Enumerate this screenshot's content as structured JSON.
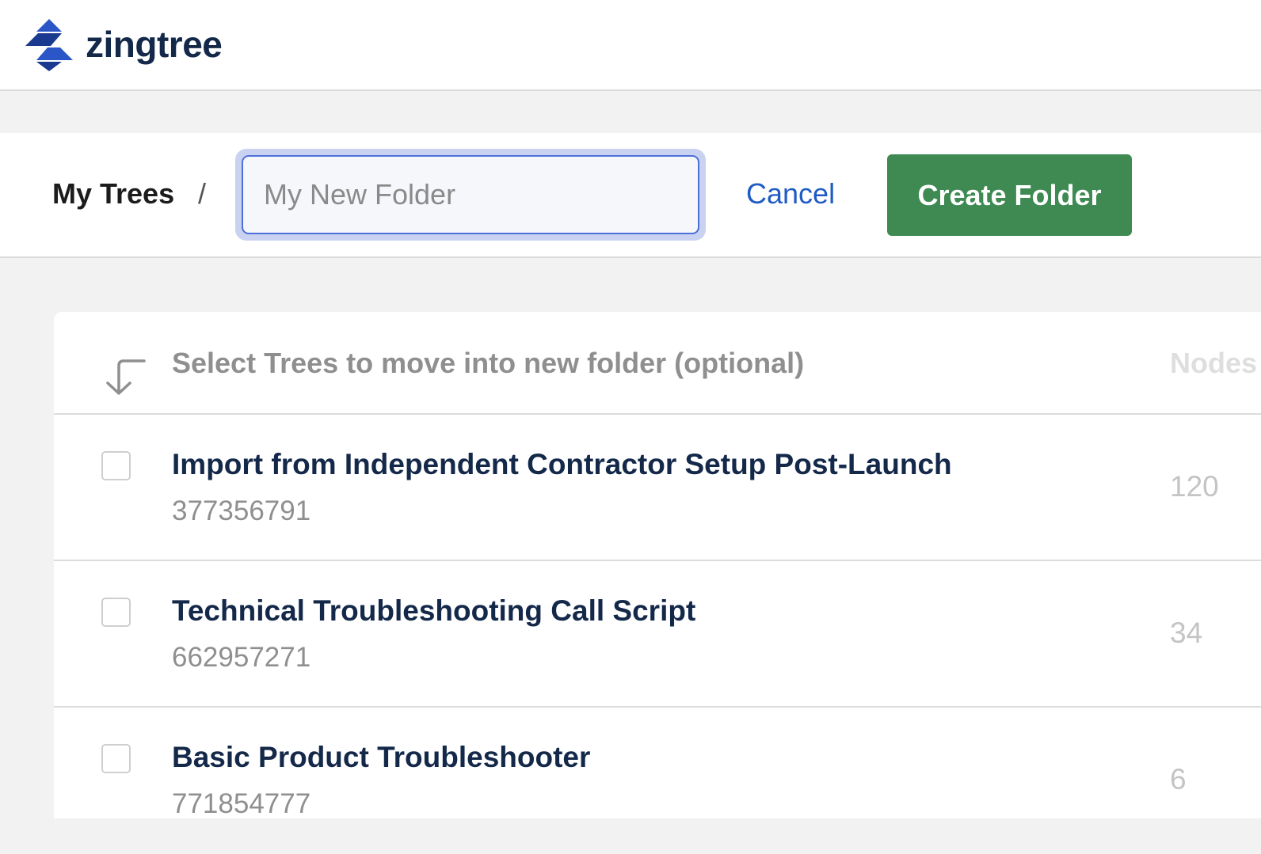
{
  "brand": {
    "name": "zingtree"
  },
  "folder_bar": {
    "breadcrumb": "My Trees",
    "separator": "/",
    "name_placeholder": "My New Folder",
    "cancel_label": "Cancel",
    "create_label": "Create Folder"
  },
  "tree_list": {
    "header_text": "Select Trees to move into new folder (optional)",
    "nodes_column": "Nodes",
    "rows": [
      {
        "title": "Import from Independent Contractor Setup Post-Launch",
        "id": "377356791",
        "nodes": "120",
        "checked": false
      },
      {
        "title": "Technical Troubleshooting Call Script",
        "id": "662957271",
        "nodes": "34",
        "checked": false
      },
      {
        "title": "Basic Product Troubleshooter",
        "id": "771854777",
        "nodes": "6",
        "checked": false
      }
    ]
  },
  "colors": {
    "brand_navy": "#14294a",
    "logo_blue": "#2a56c8",
    "link_blue": "#1f5bc4",
    "create_green": "#3e8a52",
    "focus_ring": "#c9d2f1"
  },
  "icons": [
    "zingtree-logo-icon",
    "arrow-down-left-icon",
    "checkbox-icon"
  ]
}
